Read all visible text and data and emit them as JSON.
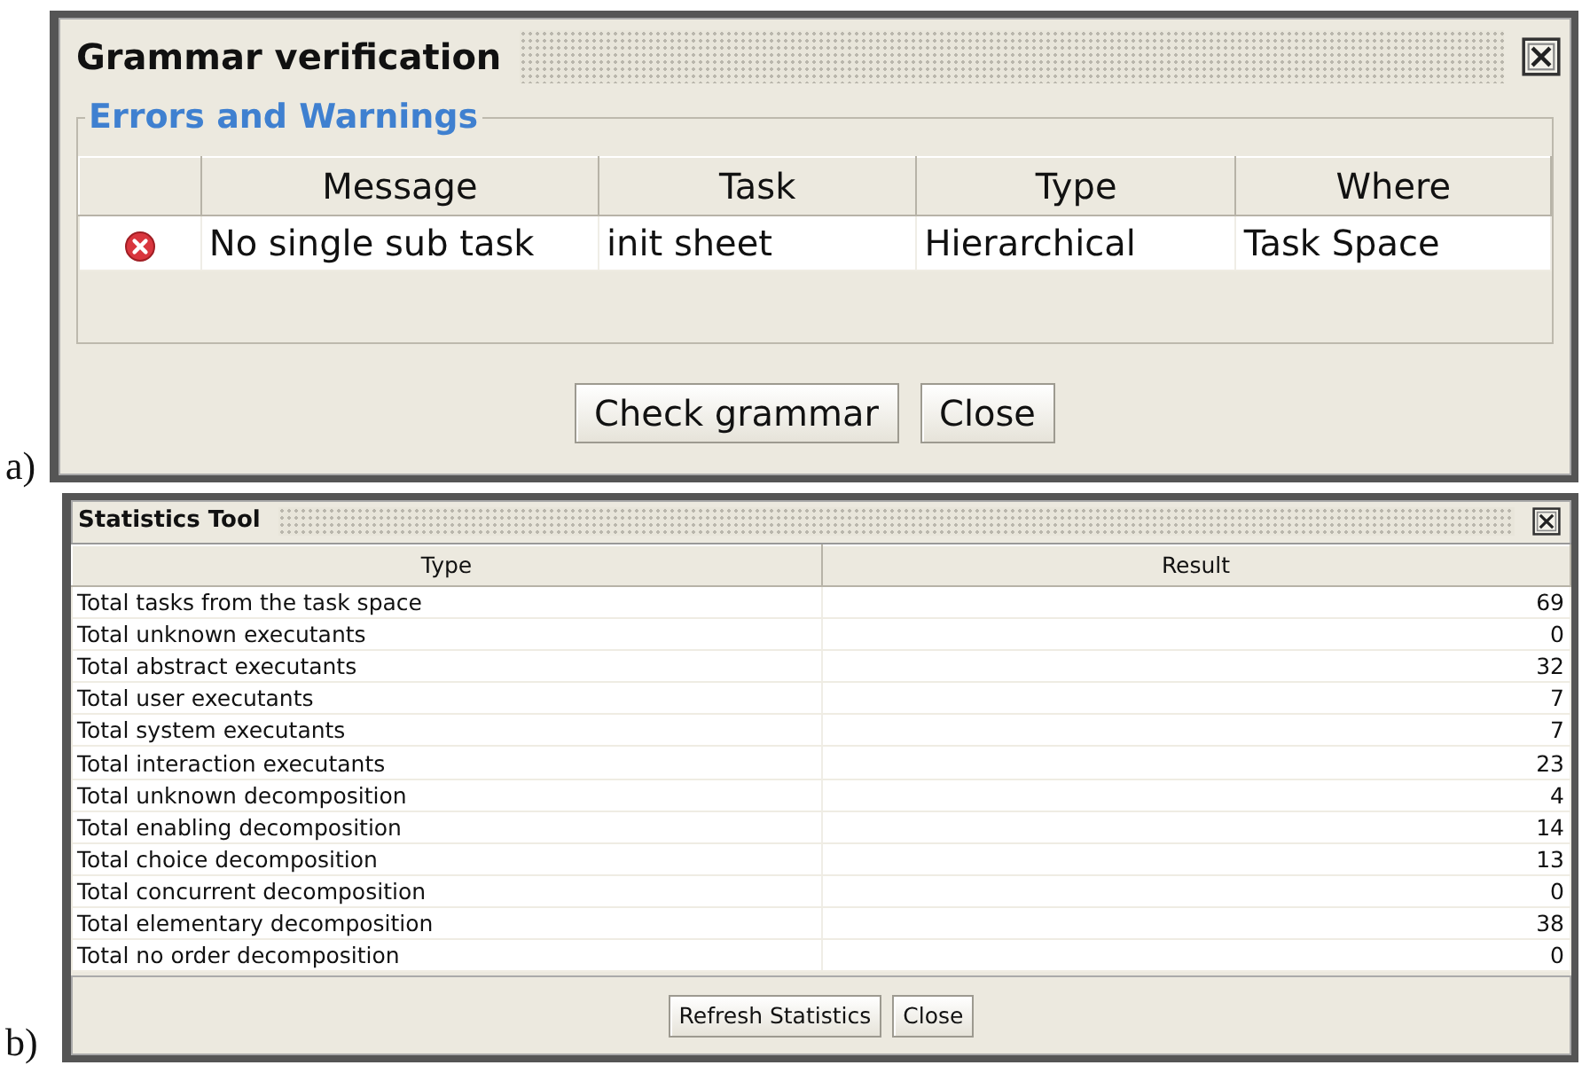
{
  "panel_a": {
    "label": "a)",
    "window": {
      "title": "Grammar verification",
      "group_title": "Errors and Warnings",
      "columns": [
        "Message",
        "Task",
        "Type",
        "Where"
      ],
      "rows": [
        {
          "kind": "error",
          "cells": [
            "No single sub task",
            "init sheet",
            "Hierarchical",
            "Task Space"
          ]
        }
      ],
      "buttons": [
        "Check grammar",
        "Close"
      ]
    }
  },
  "panel_b": {
    "label": "b)",
    "window": {
      "title": "Statistics Tool",
      "columns": [
        "Type",
        "Result"
      ],
      "rows": [
        {
          "type": "Total tasks from the task space",
          "result": "69"
        },
        {
          "type": "Total unknown executants",
          "result": "0"
        },
        {
          "type": "Total abstract executants",
          "result": "32"
        },
        {
          "type": "Total user executants",
          "result": "7"
        },
        {
          "type": "Total system executants",
          "result": "7"
        },
        {
          "type": "Total interaction executants",
          "result": "23"
        },
        {
          "type": "Total unknown decomposition",
          "result": "4"
        },
        {
          "type": "Total enabling decomposition",
          "result": "14"
        },
        {
          "type": "Total choice decomposition",
          "result": "13"
        },
        {
          "type": "Total concurrent decomposition",
          "result": "0"
        },
        {
          "type": "Total elementary decomposition",
          "result": "38"
        },
        {
          "type": "Total no order decomposition",
          "result": "0"
        }
      ],
      "buttons": [
        "Refresh Statistics",
        "Close"
      ]
    }
  }
}
